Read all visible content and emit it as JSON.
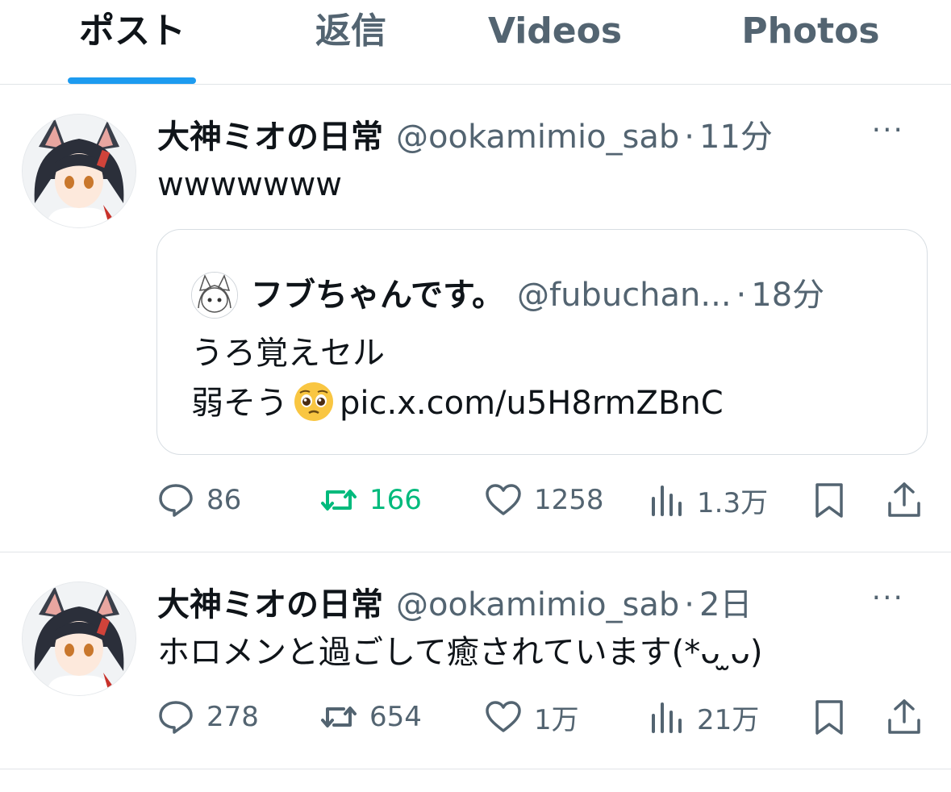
{
  "tabs": [
    {
      "label": "ポスト",
      "active": true
    },
    {
      "label": "返信",
      "active": false
    },
    {
      "label": "Videos",
      "active": false
    },
    {
      "label": "Photos",
      "active": false
    }
  ],
  "posts": [
    {
      "name": "大神ミオの日常",
      "handle": "@ookamimio_sab",
      "time": "11分",
      "more": "···",
      "text": "wwwwwww",
      "quote": {
        "name": "フブちゃんです。",
        "handle": "@fubuchan...",
        "time": "18分",
        "line1": "うろ覚えセル",
        "line2_pre": "弱そう",
        "emoji": "pleading-face",
        "line2_post": "pic.x.com/u5H8rmZBnC"
      },
      "replies": "86",
      "reposts": "166",
      "likes": "1258",
      "views": "1.3万"
    },
    {
      "name": "大神ミオの日常",
      "handle": "@ookamimio_sab",
      "time": "2日",
      "more": "···",
      "text": "ホロメンと過ごして癒されています(*ᴗ ̫ᴗ)",
      "replies": "278",
      "reposts": "654",
      "likes": "1万",
      "views": "21万"
    }
  ],
  "colors": {
    "accent": "#1d9bf0",
    "repost_active": "#00ba7c",
    "secondary_text": "#536471"
  }
}
